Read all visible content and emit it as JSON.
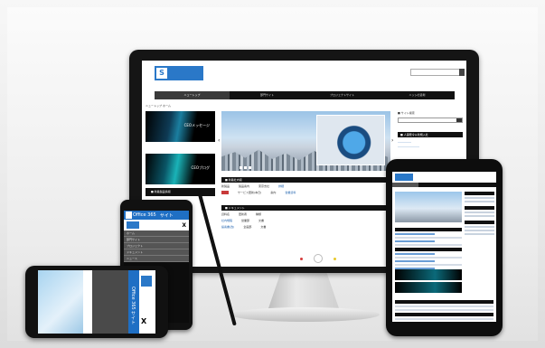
{
  "desktop": {
    "nav": [
      "ニュートップ",
      "部門サイト",
      "プロジェクトサイト",
      "ニッシの道場"
    ],
    "breadcrumb": "ニュートップ ホーム",
    "tiles": [
      "CEOメッセージ",
      "CEOブログ"
    ],
    "tile_caption": "■ 新着製品情報",
    "search_label": "■ サイト検索",
    "right_section": "■ 人事発令＆新規入社",
    "panel_news": "■ 新着社内報",
    "panel_docs": "■ ドキュメント",
    "news_rows": [
      {
        "a": "新製品",
        "b": "製品案内",
        "c": "東京支社",
        "d": "詳細"
      },
      {
        "a": "発売",
        "b": "サービス更新(本日)",
        "c": "案内",
        "d": "営業資料"
      }
    ],
    "doc_rows": [
      {
        "a": "資料名",
        "b": "更新者",
        "c": "種類"
      },
      {
        "a": "社内規程",
        "b": "営業部",
        "c": "文書"
      },
      {
        "a": "提案書(改)",
        "b": "企画部",
        "c": "文書"
      }
    ],
    "dock_colors": [
      "#d63b3b",
      "#e8c92a"
    ]
  },
  "phone": {
    "app_tabs": [
      "Office 365",
      "サイト"
    ],
    "close_glyph": "X",
    "menu": [
      "ホーム",
      "部門サイト",
      "プロジェクト",
      "ドキュメント",
      "ニュース"
    ]
  },
  "landscape_phone": {
    "app_label": "Office 365 サイト",
    "close_glyph": "X"
  }
}
